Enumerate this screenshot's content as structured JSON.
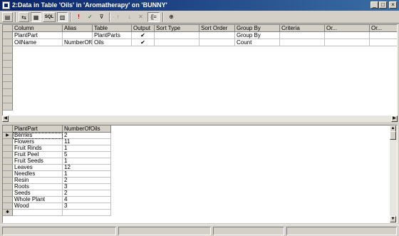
{
  "window": {
    "title": "2:Data in Table 'Oils' in 'Aromatherapy' on 'BUNNY'",
    "min_label": "_",
    "max_label": "□",
    "close_label": "×"
  },
  "toolbar": {
    "buttons": [
      {
        "name": "properties-icon",
        "glyph": "▤"
      },
      {
        "name": "diagram-pane-icon",
        "glyph": "⇆"
      },
      {
        "name": "grid-pane-icon",
        "glyph": "▦"
      },
      {
        "name": "sql-pane-label",
        "glyph": "SQL"
      },
      {
        "name": "results-pane-icon",
        "glyph": "▥"
      },
      {
        "name": "run-icon",
        "glyph": "!"
      },
      {
        "name": "verify-sql-icon",
        "glyph": "✓"
      },
      {
        "name": "remove-filter-icon",
        "glyph": "⊽"
      },
      {
        "name": "sort-ascending-icon",
        "glyph": "↑"
      },
      {
        "name": "sort-descending-icon",
        "glyph": "↓"
      },
      {
        "name": "remove-filter-2-icon",
        "glyph": "✕"
      },
      {
        "name": "group-by-icon",
        "glyph": "{[="
      },
      {
        "name": "add-table-icon",
        "glyph": "⊕"
      }
    ]
  },
  "grid_pane": {
    "columns": [
      "Column",
      "Alias",
      "Table",
      "Output",
      "Sort Type",
      "Sort Order",
      "Group By",
      "Criteria",
      "Or...",
      "Or..."
    ],
    "rows": [
      {
        "column": "PlantPart",
        "alias": "",
        "table": "PlantParts",
        "output": "✔",
        "sort_type": "",
        "sort_order": "",
        "group_by": "Group By"
      },
      {
        "column": "OilName",
        "alias": "NumberOfOils",
        "table": "Oils",
        "output": "✔",
        "sort_type": "",
        "sort_order": "",
        "group_by": "Count"
      }
    ]
  },
  "results_pane": {
    "headers": [
      "PlantPart",
      "NumberOfOils"
    ],
    "rows": [
      [
        "Berries",
        "2"
      ],
      [
        "Flowers",
        "11"
      ],
      [
        "Fruit Rinds",
        "1"
      ],
      [
        "Fruit Peel",
        "5"
      ],
      [
        "Fruit Seeds",
        "1"
      ],
      [
        "Leaves",
        "12"
      ],
      [
        "Needles",
        "1"
      ],
      [
        "Resin",
        "2"
      ],
      [
        "Roots",
        "3"
      ],
      [
        "Seeds",
        "2"
      ],
      [
        "Whole Plant",
        "4"
      ],
      [
        "Wood",
        "3"
      ]
    ],
    "current_row_marker": "▶",
    "new_row_marker": "✱"
  }
}
